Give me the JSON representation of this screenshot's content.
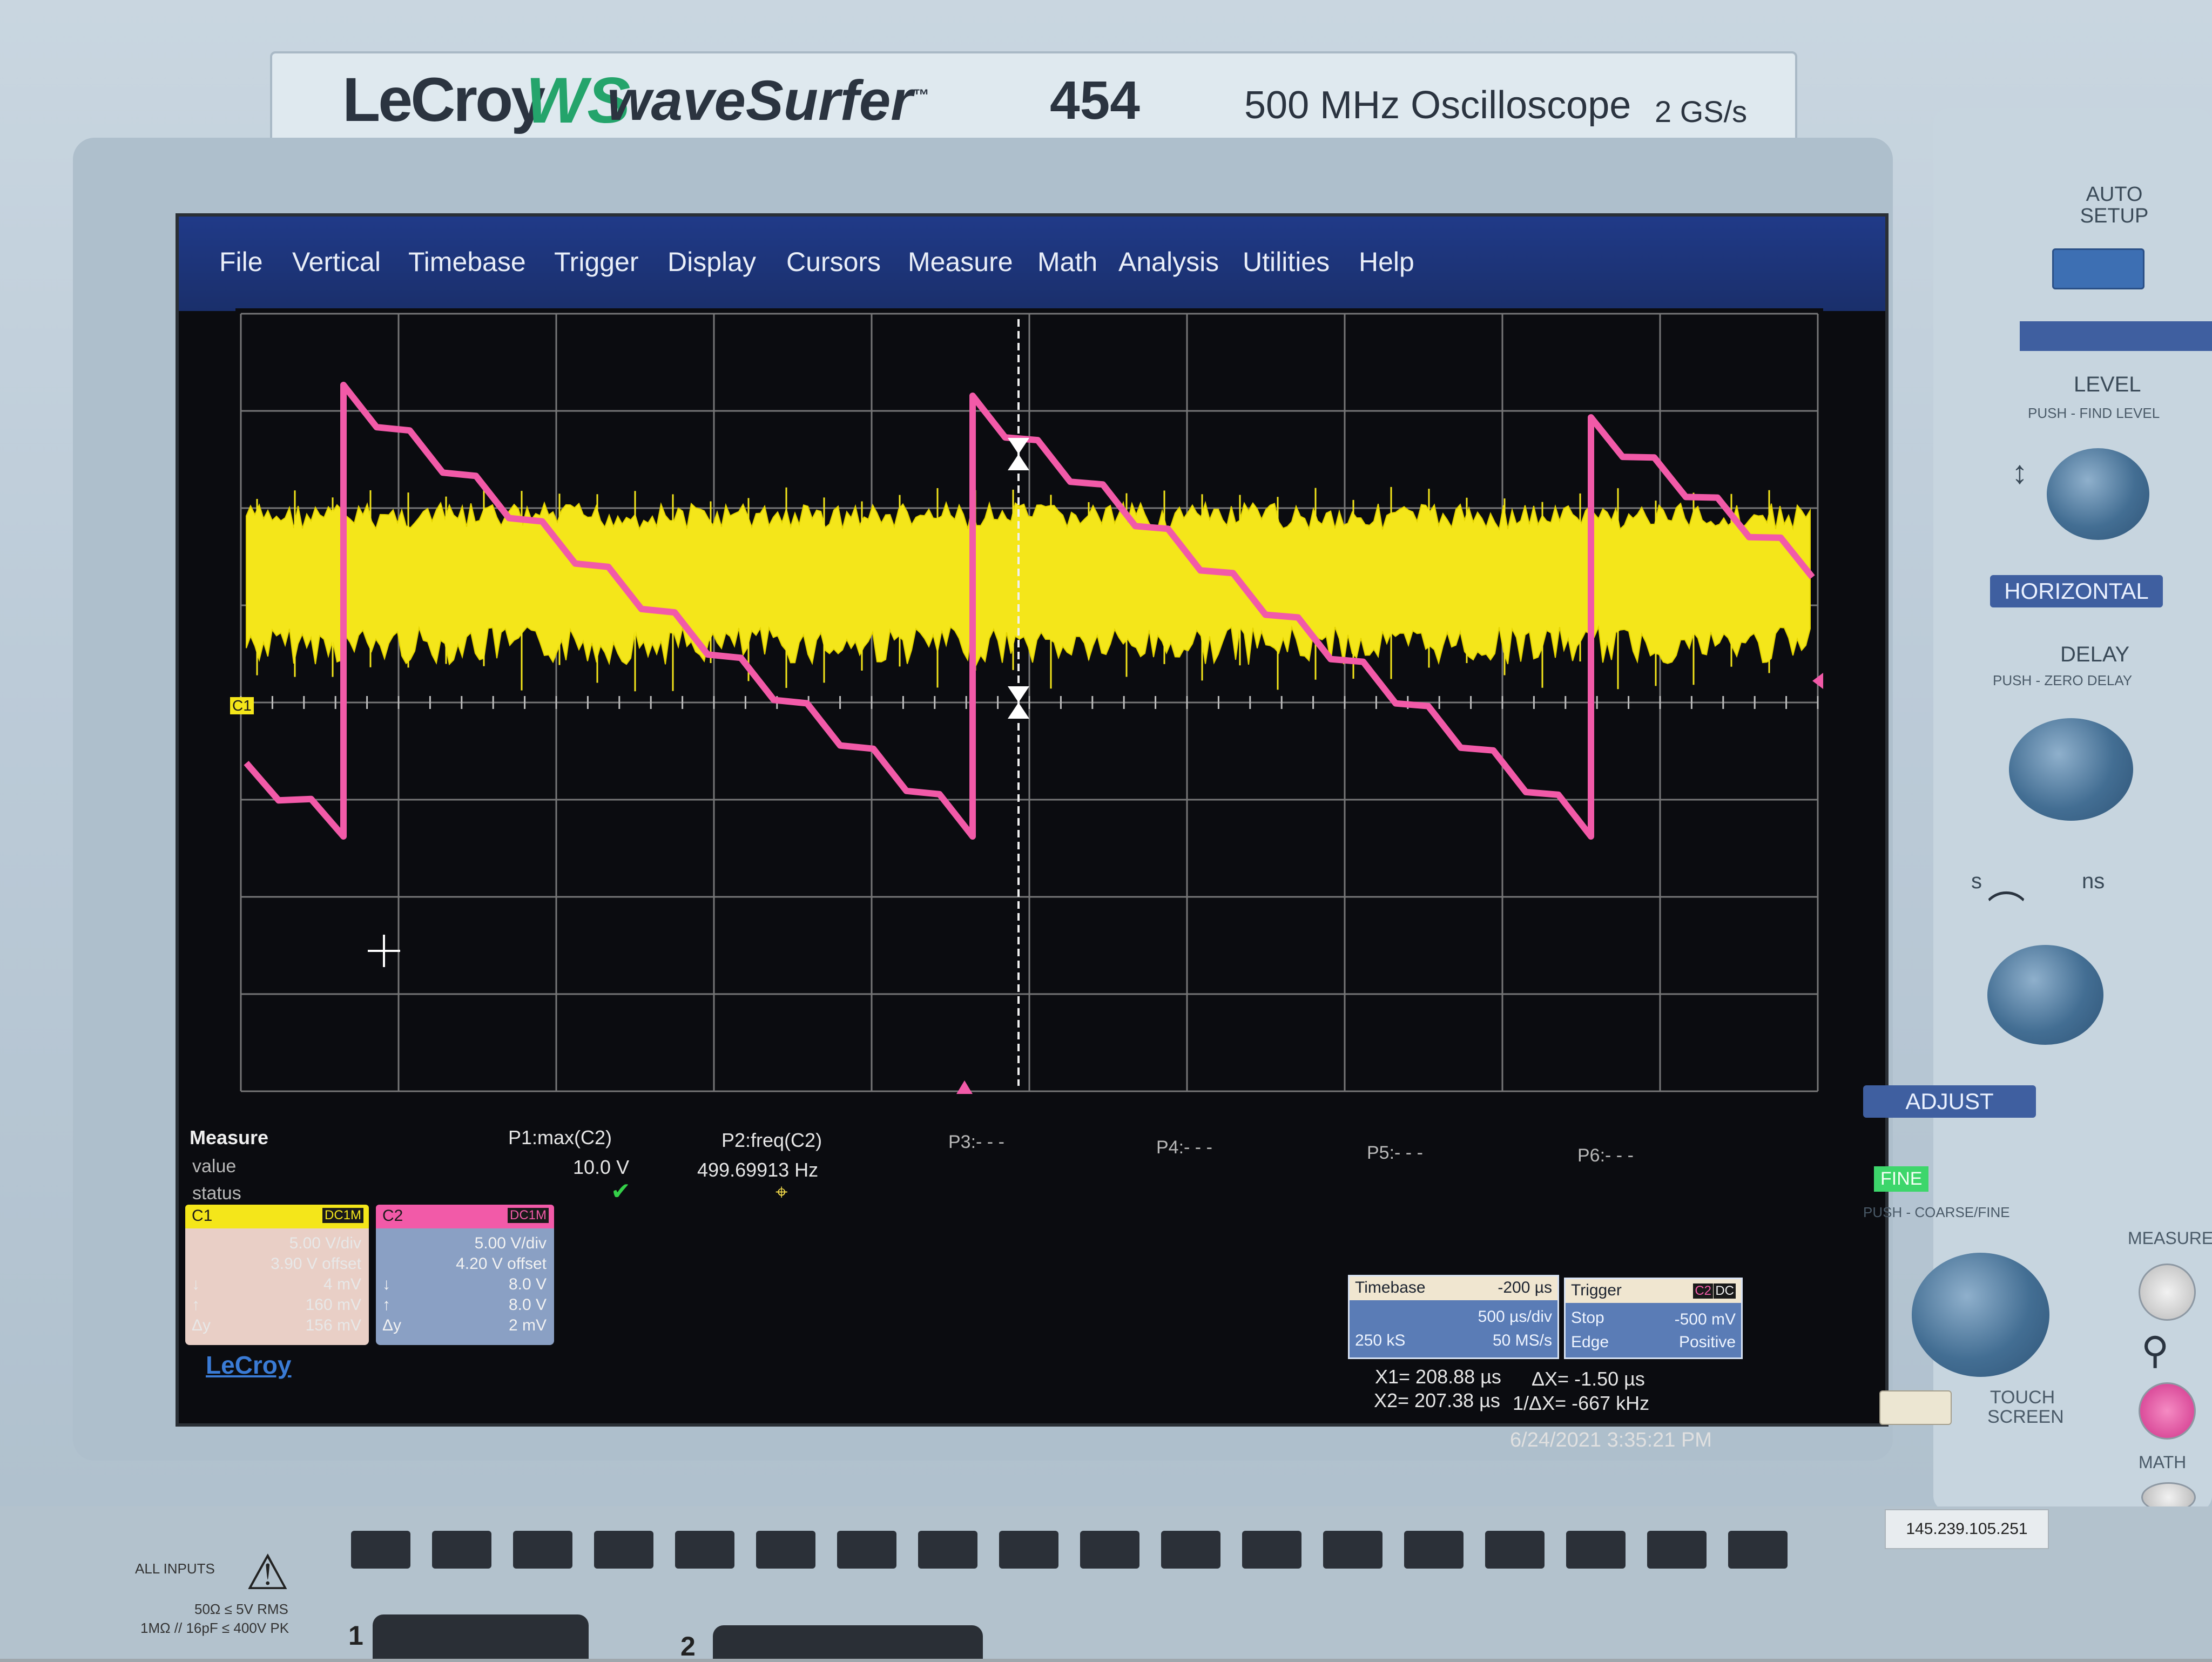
{
  "brand": {
    "logo": "LeCroy",
    "ws_mark": "WS",
    "product": "waveSurfer",
    "tm": "™",
    "model": "454",
    "description": "500 MHz Oscilloscope",
    "sample_rate": "2 GS/s"
  },
  "menu": [
    "File",
    "Vertical",
    "Timebase",
    "Trigger",
    "Display",
    "Cursors",
    "Measure",
    "Math",
    "Analysis",
    "Utilities",
    "Help"
  ],
  "channel_marker": "C1",
  "measure": {
    "title": "Measure",
    "row_value": "value",
    "row_status": "status",
    "p1_label": "P1:max(C2)",
    "p1_value": "10.0 V",
    "p2_label": "P2:freq(C2)",
    "p2_value": "499.69913 Hz",
    "p3": "P3:- - -",
    "p4": "P4:- - -",
    "p5": "P5:- - -",
    "p6": "P6:- - -"
  },
  "c1": {
    "name": "C1",
    "coupling": "DC1M",
    "vdiv": "5.00 V/div",
    "offset": "3.90 V offset",
    "down": "4 mV",
    "up": "160 mV",
    "dy_label": "Δy",
    "dy": "156 mV",
    "color": "#f4e61a"
  },
  "c2": {
    "name": "C2",
    "coupling": "DC1M",
    "vdiv": "5.00 V/div",
    "offset": "4.20 V offset",
    "down": "8.0 V",
    "up": "8.0 V",
    "dy_label": "Δy",
    "dy": "2 mV",
    "color": "#f25aa8"
  },
  "timebase": {
    "label": "Timebase",
    "delay": "-200 µs",
    "tdiv": "500 µs/div",
    "points": "250 kS",
    "rate": "50 MS/s"
  },
  "trigger": {
    "label": "Trigger",
    "src": "C2",
    "coupling": "DC",
    "mode": "Stop",
    "level": "-500 mV",
    "type": "Edge",
    "slope": "Positive"
  },
  "cursors": {
    "x1": "X1= 208.88 µs",
    "dx": "ΔX= -1.50 µs",
    "x2": "X2= 207.38 µs",
    "inv_dx": "1/ΔX= -667 kHz"
  },
  "screen_logo": "LeCroy",
  "timestamp": "6/24/2021 3:35:21 PM",
  "panel": {
    "auto_setup": "AUTO SETUP",
    "level": "LEVEL",
    "level_sub": "PUSH - FIND LEVEL",
    "horizontal": "HORIZONTAL",
    "delay": "DELAY",
    "delay_sub": "PUSH - ZERO DELAY",
    "s": "s",
    "ns": "ns",
    "adjust": "ADJUST",
    "fine": "FINE",
    "fine_sub": "PUSH - COARSE/FINE",
    "touch_screen": "TOUCH SCREEN",
    "measure": "MEASURE",
    "math": "MATH"
  },
  "bottom": {
    "all_inputs": "ALL INPUTS",
    "spec1": "50Ω ≤ 5V RMS",
    "spec2": "1MΩ // 16pF ≤ 400V PK",
    "ch1": "1",
    "ch2": "2",
    "ip": "145.239.105.251"
  }
}
